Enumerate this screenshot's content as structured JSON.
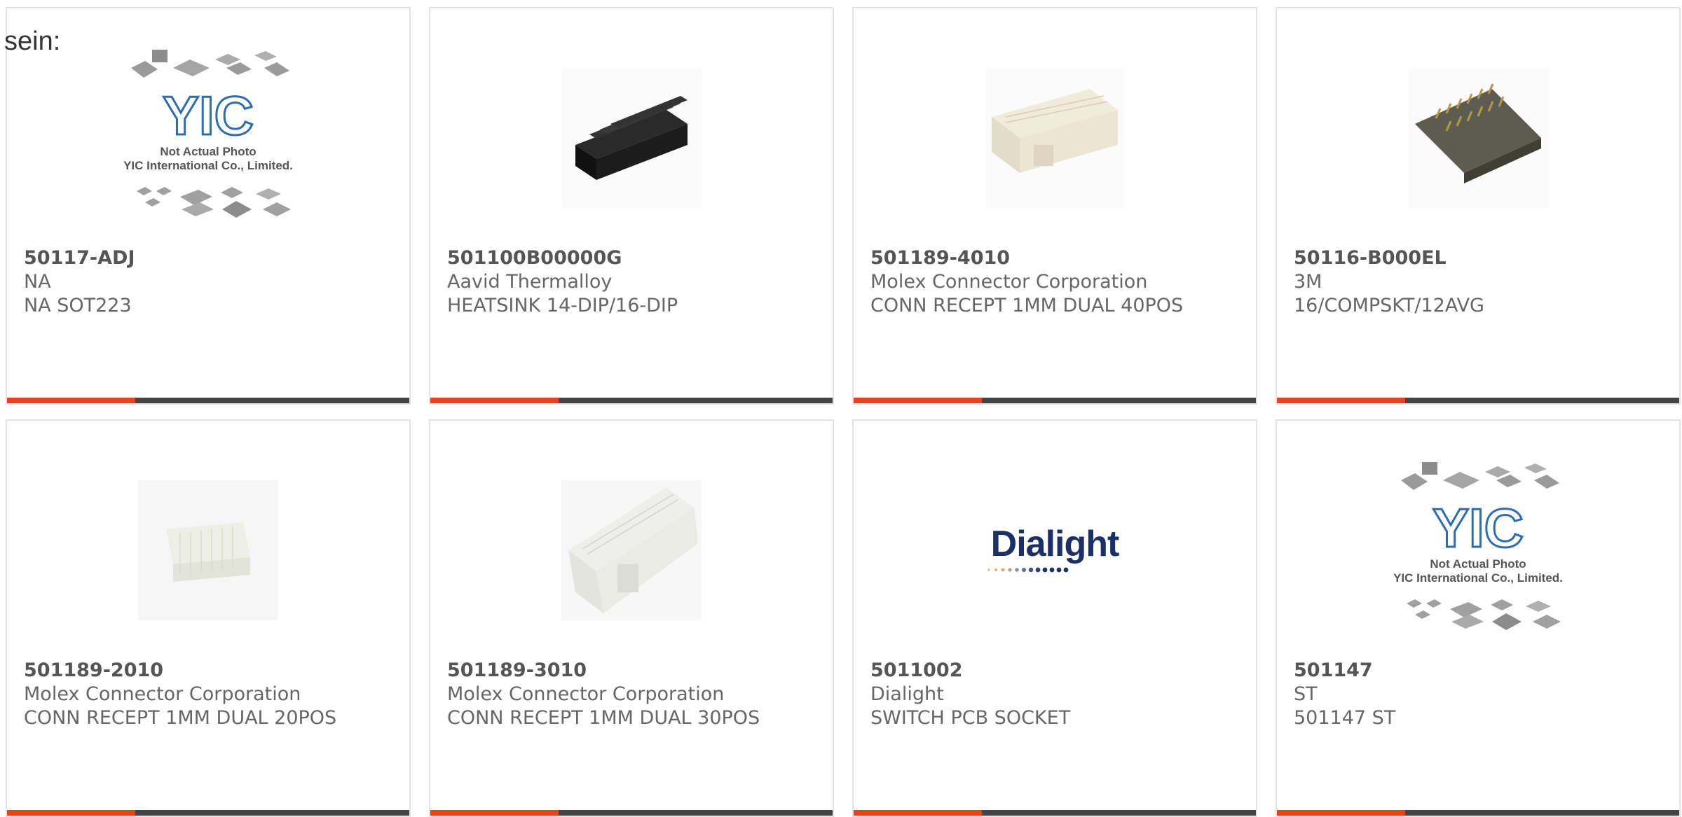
{
  "intro_text": "sein:",
  "colors": {
    "accent": "#e2451e",
    "bar_dark": "#444444",
    "text": "#666666",
    "border": "#e3e3e3"
  },
  "placeholder": {
    "line1": "Not Actual Photo",
    "line2": "YIC International Co., Limited.",
    "logo": "YIC"
  },
  "dialight_logo_text": "Dialight",
  "products": [
    {
      "part": "50117-ADJ",
      "maker": "NA",
      "desc": "NA SOT223",
      "image": "yic-placeholder"
    },
    {
      "part": "501100B00000G",
      "maker": "Aavid Thermalloy",
      "desc": "HEATSINK 14-DIP/16-DIP",
      "image": "heatsink"
    },
    {
      "part": "501189-4010",
      "maker": "Molex Connector Corporation",
      "desc": "CONN RECEPT 1MM DUAL 40POS",
      "image": "connector-40"
    },
    {
      "part": "50116-B000EL",
      "maker": "3M",
      "desc": "16/COMPSKT/12AVG",
      "image": "compsocket"
    },
    {
      "part": "501189-2010",
      "maker": "Molex Connector Corporation",
      "desc": "CONN RECEPT 1MM DUAL 20POS",
      "image": "connector-20"
    },
    {
      "part": "501189-3010",
      "maker": "Molex Connector Corporation",
      "desc": "CONN RECEPT 1MM DUAL 30POS",
      "image": "connector-30"
    },
    {
      "part": "5011002",
      "maker": "Dialight",
      "desc": "SWITCH PCB SOCKET",
      "image": "dialight-logo"
    },
    {
      "part": "501147",
      "maker": "ST",
      "desc": "501147 ST",
      "image": "yic-placeholder"
    }
  ]
}
